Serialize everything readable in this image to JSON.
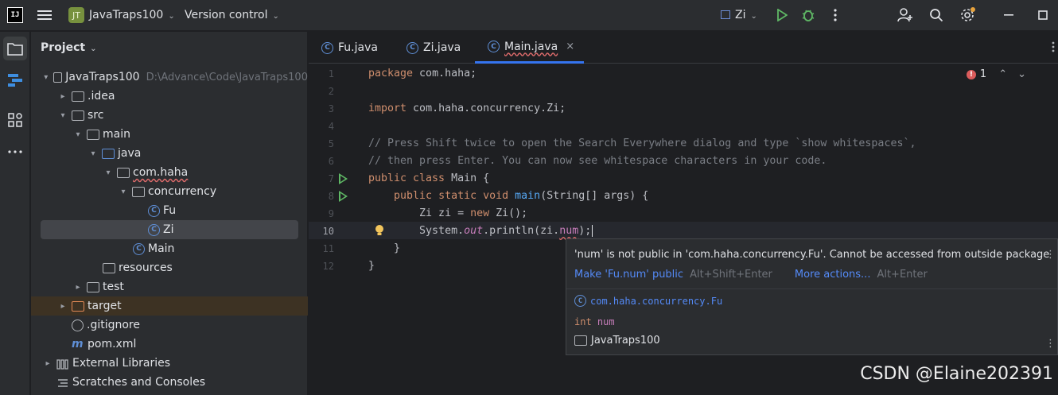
{
  "titlebar": {
    "logo": "IJ",
    "project_badge": "JT",
    "project_name": "JavaTraps100",
    "version_control": "Version control",
    "run_config": "Zi",
    "icons": [
      "hamburger-menu-icon",
      "run-icon",
      "debug-icon",
      "more-vert-icon",
      "add-user-icon",
      "search-icon",
      "settings-icon",
      "minimize-icon",
      "maximize-icon"
    ]
  },
  "toolstrip": {
    "icons": [
      "project-folder-icon",
      "structure-icon",
      "plugins-icon",
      "more-horiz-icon"
    ]
  },
  "project_panel": {
    "title": "Project",
    "tree": [
      {
        "label": "JavaTraps100",
        "hint": "D:\\Advance\\Code\\JavaTraps100",
        "type": "module",
        "expanded": true
      },
      {
        "label": ".idea",
        "type": "folder",
        "expanded": false
      },
      {
        "label": "src",
        "type": "folder",
        "expanded": true
      },
      {
        "label": "main",
        "type": "folder",
        "expanded": true
      },
      {
        "label": "java",
        "type": "source-folder",
        "expanded": true
      },
      {
        "label": "com.haha",
        "type": "package",
        "expanded": true
      },
      {
        "label": "concurrency",
        "type": "package",
        "expanded": true
      },
      {
        "label": "Fu",
        "type": "class"
      },
      {
        "label": "Zi",
        "type": "class",
        "selected": true
      },
      {
        "label": "Main",
        "type": "class"
      },
      {
        "label": "resources",
        "type": "resources-folder"
      },
      {
        "label": "test",
        "type": "folder",
        "expanded": false
      },
      {
        "label": "target",
        "type": "excluded-folder",
        "expanded": false
      },
      {
        "label": ".gitignore",
        "type": "ignore-file"
      },
      {
        "label": "pom.xml",
        "type": "maven-file"
      },
      {
        "label": "External Libraries",
        "type": "libraries",
        "expanded": false
      },
      {
        "label": "Scratches and Consoles",
        "type": "scratches"
      }
    ]
  },
  "editor": {
    "tabs": [
      {
        "label": "Fu.java",
        "active": false
      },
      {
        "label": "Zi.java",
        "active": false
      },
      {
        "label": "Main.java",
        "active": true,
        "close": "×"
      }
    ],
    "error_count": "1",
    "line_numbers": [
      "1",
      "2",
      "3",
      "4",
      "5",
      "6",
      "7",
      "8",
      "9",
      "10",
      "11",
      "12"
    ],
    "current_line": "10",
    "lines": {
      "l1_kw": "package",
      "l1_rest": " com.haha;",
      "l3_kw": "import",
      "l3_rest": " com.haha.concurrency.Zi;",
      "l5": "// Press Shift twice to open the Search Everywhere dialog and type `show whitespaces`,",
      "l6": "// then press Enter. You can now see whitespace characters in your code.",
      "l7_kw": "public class",
      "l7_rest": " Main {",
      "l8_indent": "    ",
      "l8_kw": "public static void",
      "l8_sp": " ",
      "l8_fn": "main",
      "l8_rest": "(String[] args) {",
      "l9_a": "        Zi zi = ",
      "l9_kw": "new",
      "l9_b": " Zi();",
      "l10_a": "        System.",
      "l10_out": "out",
      "l10_b": ".println(zi.",
      "l10_fld": "num",
      "l10_c": ");",
      "l11": "    }",
      "l12": "}"
    }
  },
  "popup": {
    "message": "'num' is not public in 'com.haha.concurrency.Fu'. Cannot be accessed from outside package",
    "action1": "Make 'Fu.num' public",
    "action1_shortcut": "Alt+Shift+Enter",
    "action2": "More actions...",
    "action2_shortcut": "Alt+Enter",
    "class_ref": "com.haha.concurrency.Fu",
    "decl_type": "int",
    "decl_name": "num",
    "module": "JavaTraps100"
  },
  "watermark": "CSDN @Elaine202391",
  "colors": {
    "background": "#1e1f22",
    "panel": "#2b2d30",
    "keyword": "#cf8e6d",
    "comment": "#7a7e85",
    "function": "#56a8f5",
    "field": "#c77dbb",
    "link": "#548af7",
    "error": "#db5c5c",
    "run_green": "#5fb865"
  }
}
